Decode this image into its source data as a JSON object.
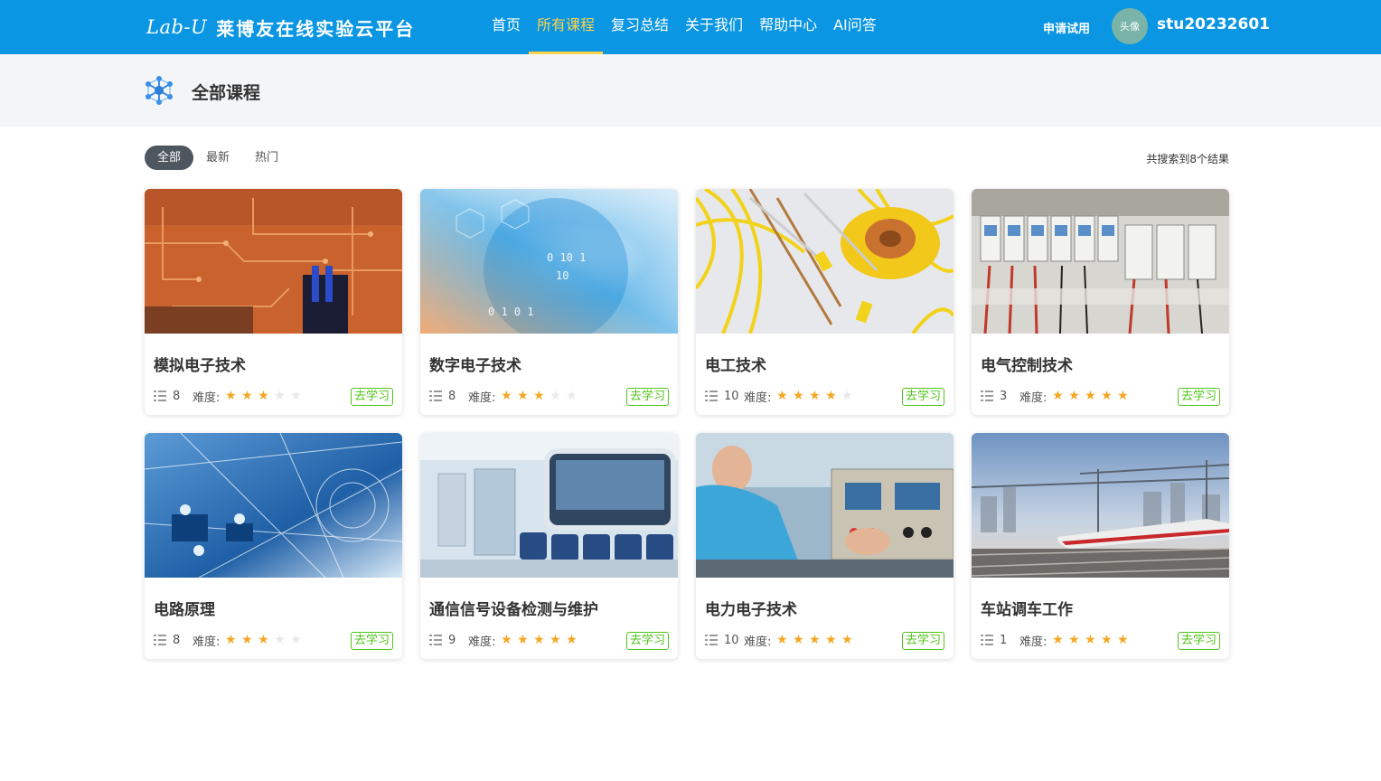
{
  "header": {
    "logo_latin": "Lab-U",
    "logo_cn": "莱博友在线实验云平台",
    "nav": [
      {
        "label": "首页",
        "active": false
      },
      {
        "label": "所有课程",
        "active": true
      },
      {
        "label": "复习总结",
        "active": false
      },
      {
        "label": "关于我们",
        "active": false
      },
      {
        "label": "帮助中心",
        "active": false
      },
      {
        "label": "AI问答",
        "active": false
      }
    ],
    "trial_label": "申请试用",
    "avatar_text": "头像",
    "username": "stu20232601"
  },
  "page": {
    "title": "全部课程",
    "title_icon": "molecule-icon"
  },
  "filters": [
    {
      "label": "全部",
      "active": true
    },
    {
      "label": "最新",
      "active": false
    },
    {
      "label": "热门",
      "active": false
    }
  ],
  "result_count": "共搜索到8个结果",
  "card_labels": {
    "difficulty": "难度:",
    "go": "去学习"
  },
  "courses": [
    {
      "title": "模拟电子技术",
      "lessons": "8",
      "difficulty": 3,
      "image": "circuit-board-orange"
    },
    {
      "title": "数字电子技术",
      "lessons": "8",
      "difficulty": 3,
      "image": "digital-globe"
    },
    {
      "title": "电工技术",
      "lessons": "10",
      "difficulty": 4,
      "image": "yellow-cables-coil"
    },
    {
      "title": "电气控制技术",
      "lessons": "3",
      "difficulty": 5,
      "image": "relay-panel"
    },
    {
      "title": "电路原理",
      "lessons": "8",
      "difficulty": 3,
      "image": "blue-circuit-network"
    },
    {
      "title": "通信信号设备检测与维护",
      "lessons": "9",
      "difficulty": 5,
      "image": "metro-car-interior"
    },
    {
      "title": "电力电子技术",
      "lessons": "10",
      "difficulty": 5,
      "image": "lab-technician"
    },
    {
      "title": "车站调车工作",
      "lessons": "1",
      "difficulty": 5,
      "image": "high-speed-train"
    }
  ],
  "colors": {
    "nav_bg": "#0a96e3",
    "nav_active": "#ffd24a",
    "star": "#f5a623",
    "go_button": "#52c41a",
    "filter_active_bg": "#4e5660"
  }
}
